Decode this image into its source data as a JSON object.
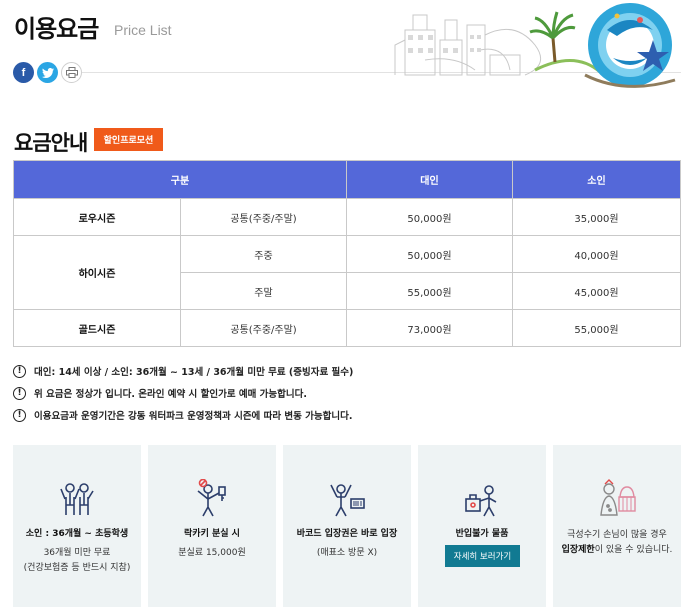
{
  "header": {
    "title": "이용요금",
    "subtitle": "Price List",
    "social": {
      "facebook": "f",
      "twitter": "t",
      "print": "P"
    }
  },
  "section": {
    "title": "요금안내",
    "promo_button": "할인프로모션"
  },
  "table": {
    "headers": [
      "구분",
      "대인",
      "소인"
    ],
    "rows": [
      {
        "season": "로우시즌",
        "day": "공통(주중/주말)",
        "adult": "50,000원",
        "child": "35,000원"
      },
      {
        "season": "하이시즌",
        "day": "주중",
        "adult": "50,000원",
        "child": "40,000원"
      },
      {
        "season": "하이시즌",
        "day": "주말",
        "adult": "55,000원",
        "child": "45,000원"
      },
      {
        "season": "골드시즌",
        "day": "공통(주중/주말)",
        "adult": "73,000원",
        "child": "55,000원"
      }
    ]
  },
  "notes": [
    "대인: 14세 이상 / 소인: 36개월 ~ 13세 / 36개월 미만 무료 (증빙자료 필수)",
    "위 요금은 정상가 입니다. 온라인 예약 시 할인가로 예매 가능합니다.",
    "이용요금과 운영기간은 강동 워터파크 운영정책과 시즌에 따라 변동 가능합니다."
  ],
  "cards": [
    {
      "icon": "children-icon",
      "title": "소인 : 36개월 ~ 초등학생",
      "desc1": "36개월 미만 무료",
      "desc2": "(건강보험증 등 반드시 지참)"
    },
    {
      "icon": "locker-key-icon",
      "title": "락카키 분실 시",
      "desc1": "분실료 15,000원",
      "desc2": ""
    },
    {
      "icon": "barcode-ticket-icon",
      "title": "바코드 입장권은 바로 입장",
      "desc1": "(매표소 방문 X)",
      "desc2": ""
    },
    {
      "icon": "prohibited-items-icon",
      "title": "반입불가 물품",
      "button": "자세히 보러가기"
    },
    {
      "icon": "crowd-limit-icon",
      "line1": "극성수기 손님이 많을 경우",
      "line2_bold": "입장제한",
      "line2_rest": "이 있을 수 있습니다."
    }
  ],
  "colors": {
    "table_header": "#5468d9",
    "promo": "#f05a1a",
    "detail_button": "#117a92",
    "card_bg": "#eef3f4"
  }
}
